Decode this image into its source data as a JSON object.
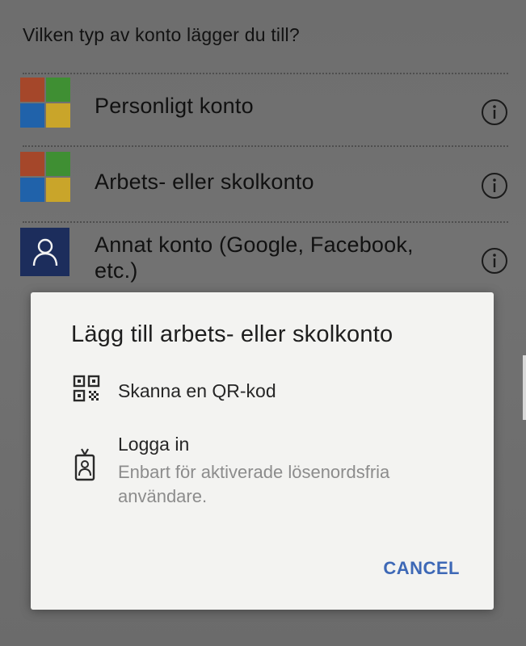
{
  "question": "Vilken typ av konto lägger du till?",
  "accounts": [
    {
      "label": "Personligt konto",
      "icon": "microsoft-logo-icon"
    },
    {
      "label": "Arbets- eller skolkonto",
      "icon": "microsoft-logo-icon"
    },
    {
      "label_line1": "Annat konto (Google, Facebook,",
      "label_line2": "etc.)",
      "icon": "person-icon"
    }
  ],
  "dialog": {
    "title": "Lägg till arbets- eller skolkonto",
    "options": [
      {
        "label": "Skanna en QR-kod",
        "icon": "qr-code-icon"
      },
      {
        "label": "Logga in",
        "sublabel_line1": "Enbart för aktiverade lösenordsfria",
        "sublabel_line2": "användare.",
        "icon": "id-badge-icon"
      }
    ],
    "cancel_label": "CANCEL"
  },
  "colors": {
    "ms_red": "#a5472a",
    "ms_green": "#3f8f33",
    "ms_blue": "#2062aa",
    "ms_yellow": "#c9a52a",
    "person_bg": "#1c2d5c",
    "accent": "#3d68b6"
  }
}
